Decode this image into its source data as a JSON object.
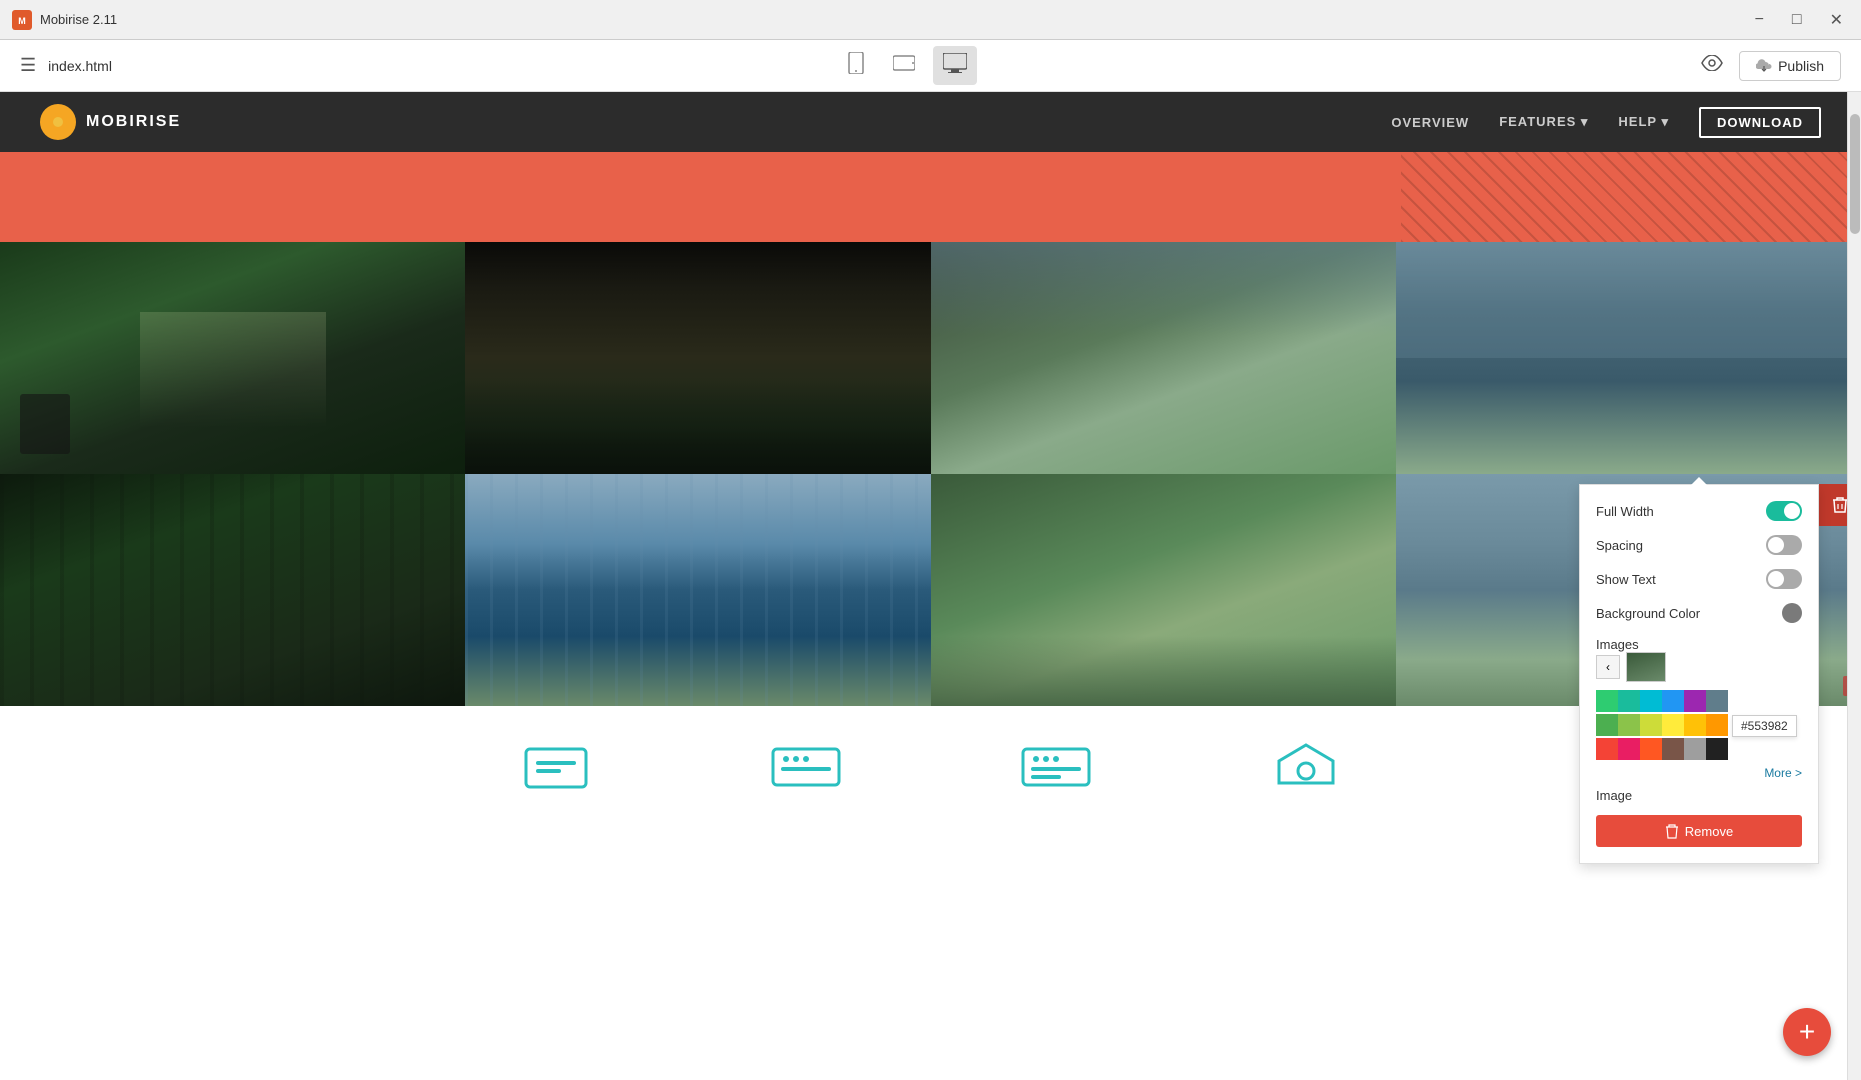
{
  "titlebar": {
    "app_name": "Mobirise 2.11",
    "minimize_label": "−",
    "maximize_label": "□",
    "close_label": "✕"
  },
  "toolbar": {
    "hamburger_label": "☰",
    "file_name": "index.html",
    "device_mobile_label": "📱",
    "device_tablet_label": "⬛",
    "device_desktop_label": "🖥",
    "preview_label": "👁",
    "publish_icon": "☁",
    "publish_label": "Publish"
  },
  "site_nav": {
    "logo_icon": "☀",
    "logo_text": "MOBIRISE",
    "links": [
      "OVERVIEW",
      "FEATURES",
      "HELP",
      "DOWNLOAD"
    ]
  },
  "section_toolbar": {
    "refresh_icon": "⇅",
    "code_icon": "</>",
    "gear_icon": "⚙",
    "trash_icon": "🗑"
  },
  "settings_panel": {
    "full_width_label": "Full Width",
    "full_width_on": true,
    "spacing_label": "Spacing",
    "spacing_on": false,
    "show_text_label": "Show Text",
    "show_text_on": false,
    "bg_color_label": "Background Color",
    "images_label": "Images",
    "image_label": "Image",
    "more_label": "More >",
    "color_hex": "#553982",
    "remove_label": "Remove",
    "remove_icon": "🗑"
  },
  "color_palette": {
    "row1": [
      "c1",
      "c2",
      "c3",
      "c4",
      "c5",
      "c6"
    ],
    "row2": [
      "c7",
      "c8",
      "c9",
      "c10",
      "c11",
      "c12"
    ],
    "row3": [
      "c16",
      "c17",
      "c13",
      "c14",
      "c15",
      "c24"
    ]
  },
  "fab": {
    "label": "+"
  }
}
